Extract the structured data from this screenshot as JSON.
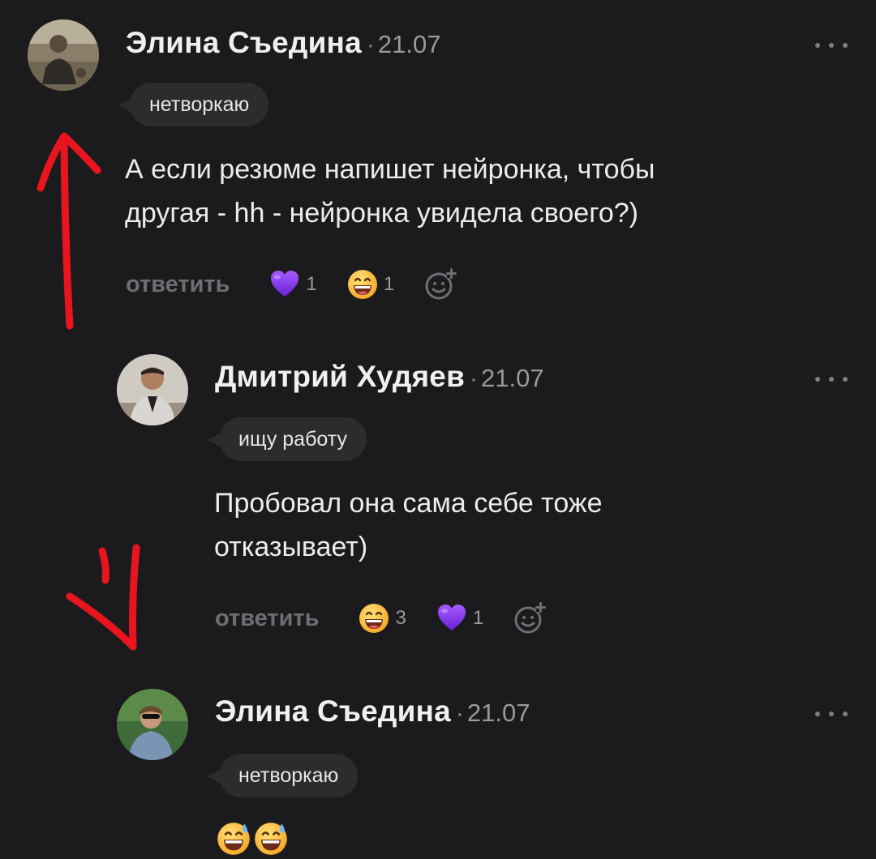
{
  "comments": [
    {
      "author": "Элина Съедина",
      "separator": "·",
      "date": "21.07",
      "badge": "нетворкаю",
      "text": "А если резюме напишет нейронка, чтобы\nдругая - hh - нейронка увидела своего?)",
      "reply_label": "ответить",
      "reactions": [
        {
          "icon": "purple-heart-icon",
          "count": "1"
        },
        {
          "icon": "grinning-face-icon",
          "count": "1"
        }
      ]
    },
    {
      "author": "Дмитрий Худяев",
      "separator": "·",
      "date": "21.07",
      "badge": "ищу работу",
      "text": "Пробовал она сама себе тоже\nотказывает)",
      "reply_label": "ответить",
      "reactions": [
        {
          "icon": "grinning-face-icon",
          "count": "3"
        },
        {
          "icon": "purple-heart-icon",
          "count": "1"
        }
      ]
    },
    {
      "author": "Элина Съедина",
      "separator": "·",
      "date": "21.07",
      "badge": "нетворкаю",
      "emoji_text": [
        "grinning-sweat-face-icon",
        "grinning-sweat-face-icon"
      ]
    }
  ],
  "colors": {
    "background": "#1b1b1d",
    "badge_bg": "#2c2c2f",
    "annotation_red": "#e8141e",
    "heart": "#8b3cf0"
  },
  "icons": {
    "more": "more-dots-icon",
    "add_reaction": "add-reaction-icon"
  }
}
